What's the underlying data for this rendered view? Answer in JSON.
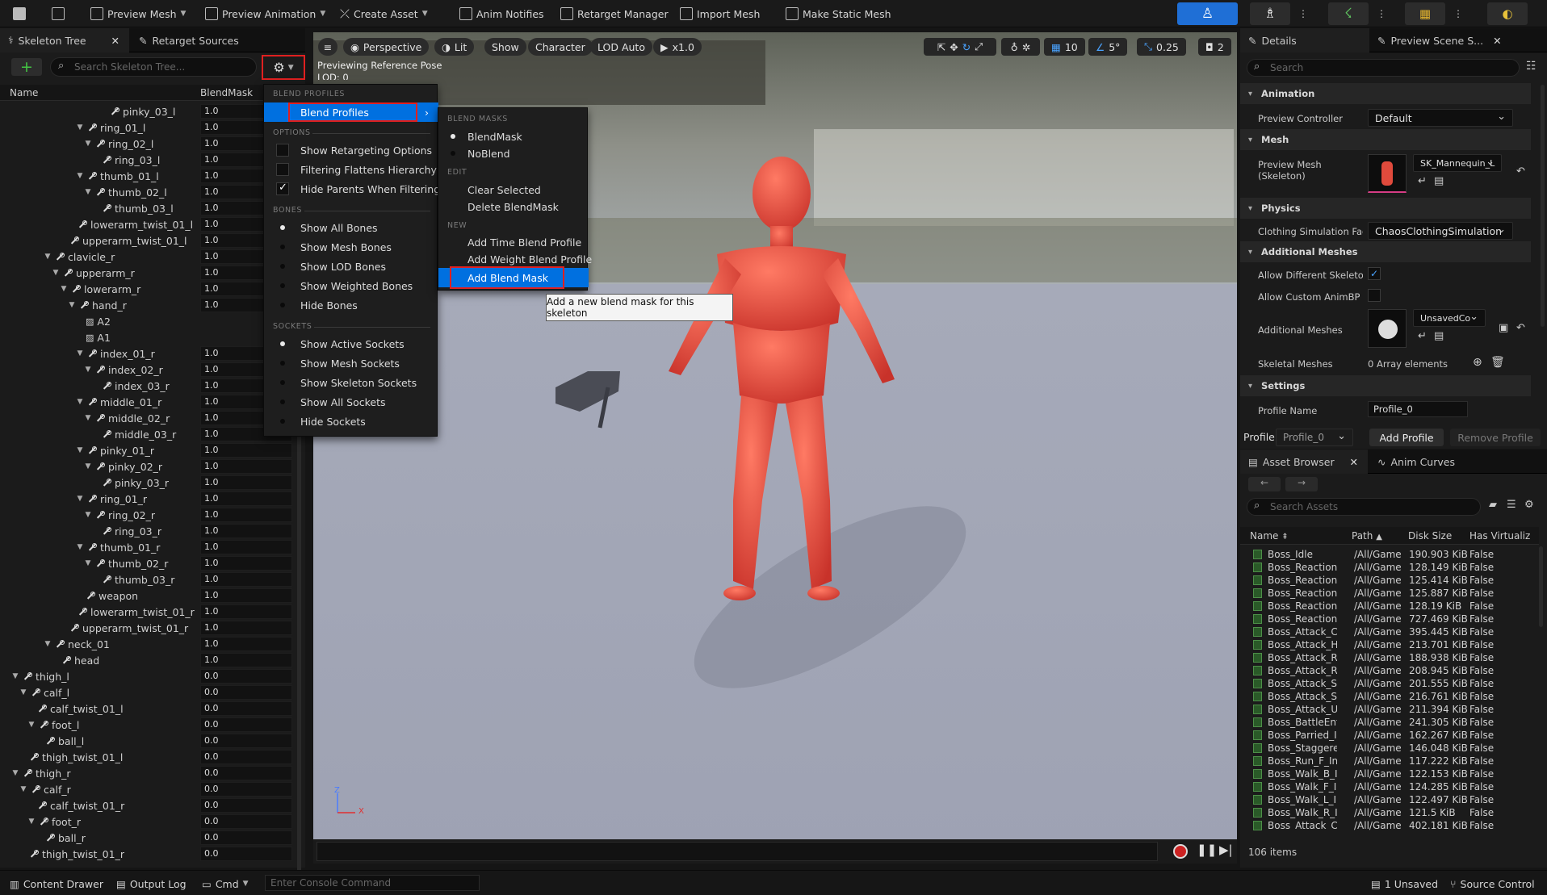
{
  "toolbar": {
    "preview_mesh": "Preview Mesh",
    "preview_animation": "Preview Animation",
    "create_asset": "Create Asset",
    "anim_notifies": "Anim Notifies",
    "retarget_manager": "Retarget Manager",
    "import_mesh": "Import Mesh",
    "make_static_mesh": "Make Static Mesh",
    "accent_color": "#1f6fd6"
  },
  "skeleton_panel": {
    "tab_skeleton_tree": "Skeleton Tree",
    "tab_retarget_sources": "Retarget Sources",
    "search_placeholder": "Search Skeleton Tree...",
    "col_name": "Name",
    "col_blendmask": "BlendMask",
    "rows": [
      {
        "name": "pinky_03_l",
        "value": "1.0"
      },
      {
        "name": "ring_01_l",
        "value": "1.0"
      },
      {
        "name": "ring_02_l",
        "value": "1.0"
      },
      {
        "name": "ring_03_l",
        "value": "1.0"
      },
      {
        "name": "thumb_01_l",
        "value": "1.0"
      },
      {
        "name": "thumb_02_l",
        "value": "1.0"
      },
      {
        "name": "thumb_03_l",
        "value": "1.0"
      },
      {
        "name": "lowerarm_twist_01_l",
        "value": "1.0"
      },
      {
        "name": "upperarm_twist_01_l",
        "value": "1.0"
      },
      {
        "name": "clavicle_r",
        "value": "1.0"
      },
      {
        "name": "upperarm_r",
        "value": "1.0"
      },
      {
        "name": "lowerarm_r",
        "value": "1.0"
      },
      {
        "name": "hand_r",
        "value": "1.0"
      },
      {
        "name": "A2",
        "value": ""
      },
      {
        "name": "A1",
        "value": ""
      },
      {
        "name": "index_01_r",
        "value": "1.0"
      },
      {
        "name": "index_02_r",
        "value": "1.0"
      },
      {
        "name": "index_03_r",
        "value": "1.0"
      },
      {
        "name": "middle_01_r",
        "value": "1.0"
      },
      {
        "name": "middle_02_r",
        "value": "1.0"
      },
      {
        "name": "middle_03_r",
        "value": "1.0"
      },
      {
        "name": "pinky_01_r",
        "value": "1.0"
      },
      {
        "name": "pinky_02_r",
        "value": "1.0"
      },
      {
        "name": "pinky_03_r",
        "value": "1.0"
      },
      {
        "name": "ring_01_r",
        "value": "1.0"
      },
      {
        "name": "ring_02_r",
        "value": "1.0"
      },
      {
        "name": "ring_03_r",
        "value": "1.0"
      },
      {
        "name": "thumb_01_r",
        "value": "1.0"
      },
      {
        "name": "thumb_02_r",
        "value": "1.0"
      },
      {
        "name": "thumb_03_r",
        "value": "1.0"
      },
      {
        "name": "weapon",
        "value": "1.0"
      },
      {
        "name": "lowerarm_twist_01_r",
        "value": "1.0"
      },
      {
        "name": "upperarm_twist_01_r",
        "value": "1.0"
      },
      {
        "name": "neck_01",
        "value": "1.0"
      },
      {
        "name": "head",
        "value": "1.0"
      },
      {
        "name": "thigh_l",
        "value": "0.0"
      },
      {
        "name": "calf_l",
        "value": "0.0"
      },
      {
        "name": "calf_twist_01_l",
        "value": "0.0"
      },
      {
        "name": "foot_l",
        "value": "0.0"
      },
      {
        "name": "ball_l",
        "value": "0.0"
      },
      {
        "name": "thigh_twist_01_l",
        "value": "0.0"
      },
      {
        "name": "thigh_r",
        "value": "0.0"
      },
      {
        "name": "calf_r",
        "value": "0.0"
      },
      {
        "name": "calf_twist_01_r",
        "value": "0.0"
      },
      {
        "name": "foot_r",
        "value": "0.0"
      },
      {
        "name": "ball_r",
        "value": "0.0"
      },
      {
        "name": "thigh_twist_01_r",
        "value": "0.0"
      }
    ]
  },
  "options_menu": {
    "sec_blend_profiles": "BLEND PROFILES",
    "blend_profiles": "Blend Profiles",
    "sec_options": "OPTIONS",
    "show_retargeting": "Show Retargeting Options",
    "filtering_flattens": "Filtering Flattens Hierarchy",
    "hide_parents": "Hide Parents When Filtering",
    "sec_bones": "BONES",
    "show_all_bones": "Show All Bones",
    "show_mesh_bones": "Show Mesh Bones",
    "show_lod_bones": "Show LOD Bones",
    "show_weighted_bones": "Show Weighted Bones",
    "hide_bones": "Hide Bones",
    "sec_sockets": "SOCKETS",
    "show_active_sockets": "Show Active Sockets",
    "show_mesh_sockets": "Show Mesh Sockets",
    "show_skeleton_sockets": "Show Skeleton Sockets",
    "show_all_sockets": "Show All Sockets",
    "hide_sockets": "Hide Sockets"
  },
  "blend_submenu": {
    "sec_blend_masks": "BLEND MASKS",
    "blendmask": "BlendMask",
    "noblend": "NoBlend",
    "sec_edit": "EDIT",
    "clear_selected": "Clear Selected",
    "delete_blendmask": "Delete BlendMask",
    "sec_new": "NEW",
    "add_time": "Add Time Blend Profile",
    "add_weight": "Add Weight Blend Profile",
    "add_blend_mask": "Add Blend Mask",
    "tooltip": "Add a new blend mask for this skeleton"
  },
  "viewport": {
    "perspective": "Perspective",
    "lit": "Lit",
    "show": "Show",
    "character": "Character",
    "lod_auto": "LOD Auto",
    "speed": "x1.0",
    "grid_size": "10",
    "rot_snap": "5°",
    "scale_snap": "0.25",
    "cam_speed": "2",
    "overlay_line1": "Previewing Reference Pose",
    "overlay_line2": "LOD: 0",
    "axis_z": "Z",
    "axis_x": "X"
  },
  "details": {
    "tab_details": "Details",
    "tab_preview_scene": "Preview Scene S...",
    "search_placeholder": "Search",
    "sec_animation": "Animation",
    "preview_controller_label": "Preview Controller",
    "preview_controller_value": "Default",
    "sec_mesh": "Mesh",
    "preview_mesh_label_1": "Preview Mesh",
    "preview_mesh_label_2": "(Skeleton)",
    "preview_mesh_value": "SK_Mannequin_L",
    "sec_physics": "Physics",
    "clothing_label": "Clothing Simulation Fact",
    "clothing_value": "ChaosClothingSimulation",
    "sec_additional": "Additional Meshes",
    "allow_diff_label": "Allow Different Skeleton",
    "allow_custom_label": "Allow Custom AnimBP C",
    "additional_meshes_label": "Additional Meshes",
    "additional_meshes_value": "UnsavedCo",
    "skeletal_meshes_label": "Skeletal Meshes",
    "skeletal_meshes_value": "0 Array elements",
    "sec_settings": "Settings",
    "profile_name_label": "Profile Name",
    "profile_name_value": "Profile_0",
    "profile_label": "Profile",
    "profile_value": "Profile_0",
    "add_profile": "Add Profile",
    "remove_profile": "Remove Profile"
  },
  "asset_browser": {
    "tab_asset_browser": "Asset Browser",
    "tab_anim_curves": "Anim Curves",
    "search_placeholder": "Search Assets",
    "col_name": "Name",
    "col_path": "Path",
    "col_disk": "Disk Size",
    "col_virtual": "Has Virtualiz",
    "items_count": "106 items",
    "rows": [
      {
        "name": "Boss_Idle",
        "path": "/All/Game",
        "size": "190.903 KiB",
        "virt": "False"
      },
      {
        "name": "Boss_ReactionHit",
        "path": "/All/Game",
        "size": "128.149 KiB",
        "virt": "False"
      },
      {
        "name": "Boss_ReactionHit",
        "path": "/All/Game",
        "size": "125.414 KiB",
        "virt": "False"
      },
      {
        "name": "Boss_ReactionHit",
        "path": "/All/Game",
        "size": "125.887 KiB",
        "virt": "False"
      },
      {
        "name": "Boss_ReactionHit",
        "path": "/All/Game",
        "size": "128.19 KiB",
        "virt": "False"
      },
      {
        "name": "Boss_ReactionHit",
        "path": "/All/Game",
        "size": "727.469 KiB",
        "virt": "False"
      },
      {
        "name": "Boss_Attack_Chai",
        "path": "/All/Game",
        "size": "395.445 KiB",
        "virt": "False"
      },
      {
        "name": "Boss_Attack_Han",
        "path": "/All/Game",
        "size": "213.701 KiB",
        "virt": "False"
      },
      {
        "name": "Boss_Attack_Runi",
        "path": "/All/Game",
        "size": "188.938 KiB",
        "virt": "False"
      },
      {
        "name": "Boss_Attack_Runi",
        "path": "/All/Game",
        "size": "208.945 KiB",
        "virt": "False"
      },
      {
        "name": "Boss_Attack_Swii",
        "path": "/All/Game",
        "size": "201.555 KiB",
        "virt": "False"
      },
      {
        "name": "Boss_Attack_Swii",
        "path": "/All/Game",
        "size": "216.761 KiB",
        "virt": "False"
      },
      {
        "name": "Boss_Attack_Upp",
        "path": "/All/Game",
        "size": "211.394 KiB",
        "virt": "False"
      },
      {
        "name": "Boss_BattleEntrar",
        "path": "/All/Game",
        "size": "241.305 KiB",
        "virt": "False"
      },
      {
        "name": "Boss_Parried_InP",
        "path": "/All/Game",
        "size": "162.267 KiB",
        "virt": "False"
      },
      {
        "name": "Boss_Staggered_I",
        "path": "/All/Game",
        "size": "146.048 KiB",
        "virt": "False"
      },
      {
        "name": "Boss_Run_F_InP",
        "path": "/All/Game",
        "size": "117.222 KiB",
        "virt": "False"
      },
      {
        "name": "Boss_Walk_B_InP",
        "path": "/All/Game",
        "size": "122.153 KiB",
        "virt": "False"
      },
      {
        "name": "Boss_Walk_F_InP",
        "path": "/All/Game",
        "size": "124.285 KiB",
        "virt": "False"
      },
      {
        "name": "Boss_Walk_L_InP",
        "path": "/All/Game",
        "size": "122.497 KiB",
        "virt": "False"
      },
      {
        "name": "Boss_Walk_R_InP",
        "path": "/All/Game",
        "size": "121.5 KiB",
        "virt": "False"
      },
      {
        "name": "Boss_Attack_Chai",
        "path": "/All/Game",
        "size": "402.181 KiB",
        "virt": "False"
      }
    ]
  },
  "statusbar": {
    "content_drawer": "Content Drawer",
    "output_log": "Output Log",
    "cmd": "Cmd",
    "console_placeholder": "Enter Console Command",
    "unsaved": "1 Unsaved",
    "source_control": "Source Control"
  }
}
